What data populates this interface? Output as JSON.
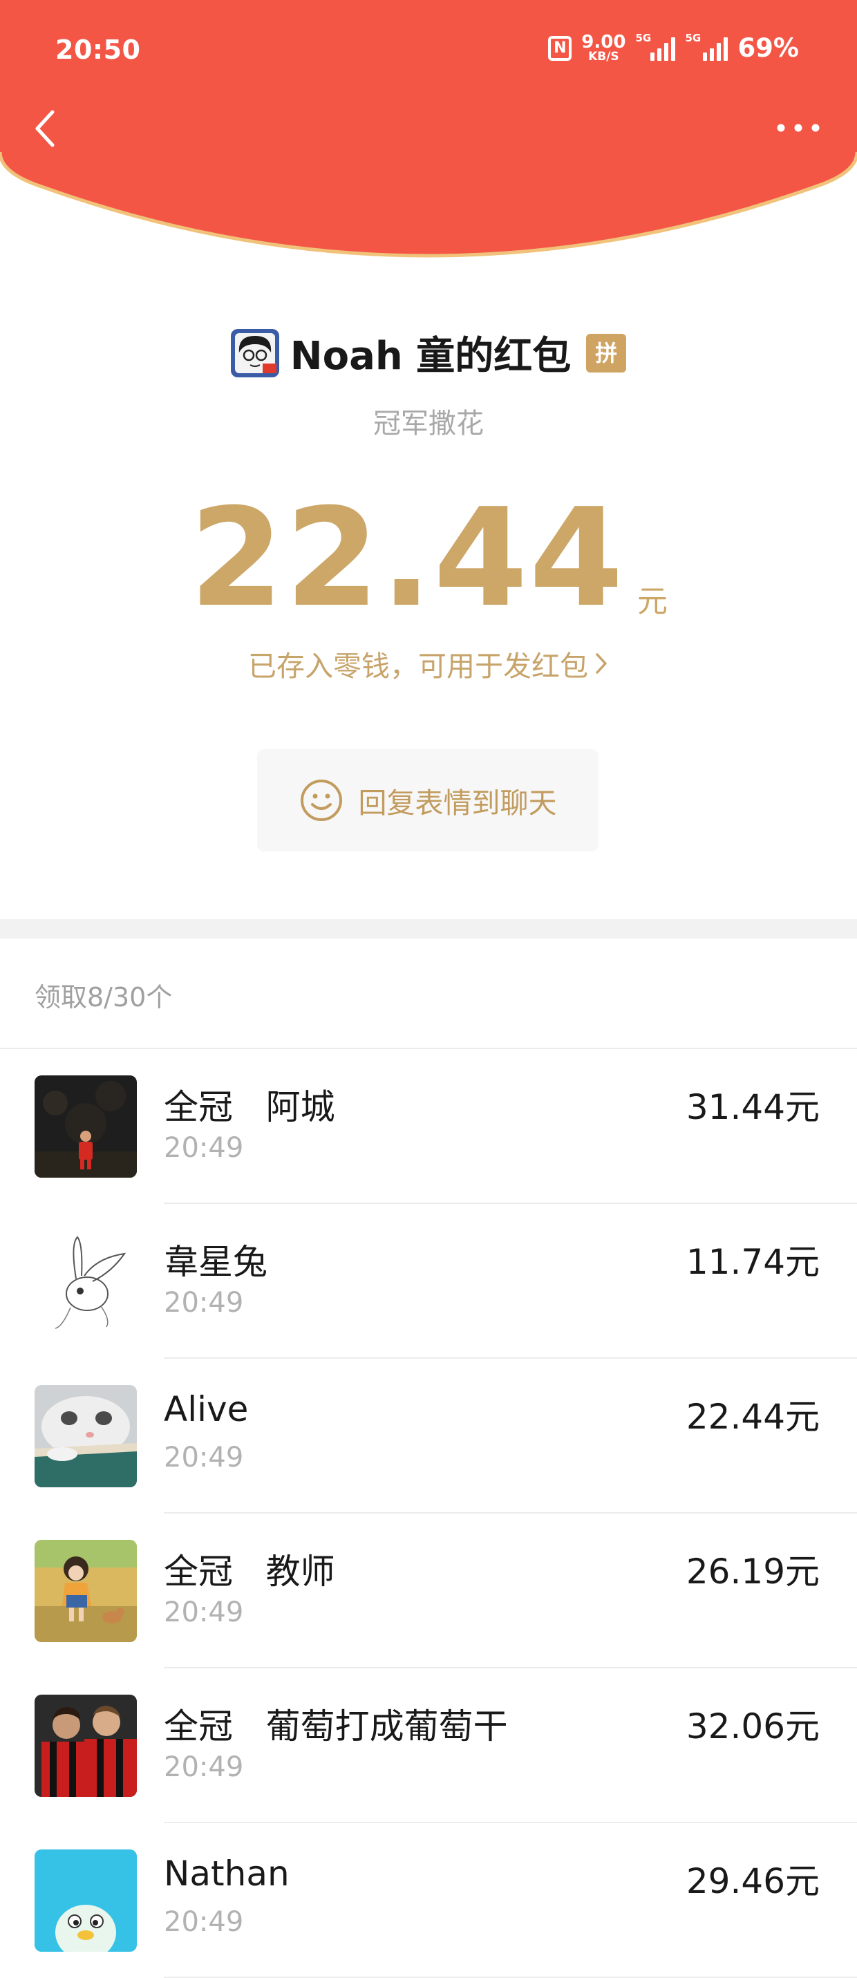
{
  "colors": {
    "header_red": "#f45646",
    "header_rim": "#f0c27a",
    "gold": "#cca768",
    "separator": "#f2f2f2"
  },
  "status_bar": {
    "time": "20:50",
    "net_speed_value": "9.00",
    "net_speed_unit": "KB/S",
    "signal_1_tag": "5G",
    "signal_2_tag": "5G",
    "battery": "69%"
  },
  "nav": {
    "back_icon": "chevron-left-icon",
    "more_icon": "more-dots-icon"
  },
  "sender": {
    "name": "Noah 童的红包",
    "badge": "拼",
    "greeting": "冠军撒花"
  },
  "amount": {
    "value": "22.44",
    "unit": "元",
    "stored_note": "已存入零钱，可用于发红包"
  },
  "reply": {
    "icon": "smiley-icon",
    "label": "回复表情到聊天"
  },
  "received_summary": "领取8/30个",
  "records": [
    {
      "name": "全冠   阿城",
      "time": "20:49",
      "amount": "31.44元",
      "avatar": "soccer-player-avatar"
    },
    {
      "name": "韋星兔",
      "time": "20:49",
      "amount": "11.74元",
      "avatar": "rabbit-sketch-avatar"
    },
    {
      "name": "Alive",
      "time": "20:49",
      "amount": "22.44元",
      "avatar": "cat-avatar"
    },
    {
      "name": "全冠   教师",
      "time": "20:49",
      "amount": "26.19元",
      "avatar": "anime-girl-avatar"
    },
    {
      "name": "全冠   葡萄打成葡萄干",
      "time": "20:49",
      "amount": "32.06元",
      "avatar": "football-players-avatar"
    },
    {
      "name": "Nathan",
      "time": "20:49",
      "amount": "29.46元",
      "avatar": "cartoon-bird-avatar"
    }
  ]
}
